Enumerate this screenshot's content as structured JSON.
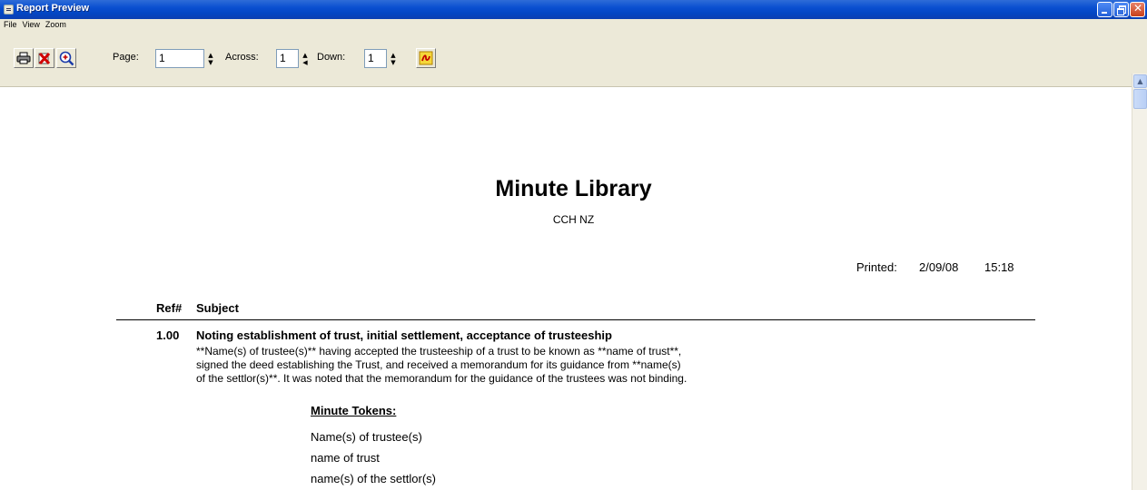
{
  "window": {
    "title": "Report Preview"
  },
  "menu": {
    "items": [
      "File",
      "View",
      "Zoom"
    ]
  },
  "toolbar": {
    "page_label": "Page:",
    "page_value": "1",
    "across_label": "Across:",
    "across_value": "1",
    "down_label": "Down:",
    "down_value": "1",
    "icons": [
      "printer-icon",
      "close-red-x-icon",
      "zoom-in-icon",
      "pdf-export-icon"
    ]
  },
  "report": {
    "title": "Minute Library",
    "subtitle": "CCH NZ",
    "printed_label": "Printed:",
    "printed_date": "2/09/08",
    "printed_time": "15:18",
    "col_ref": "Ref#",
    "col_subject": "Subject",
    "entries": [
      {
        "ref": "1.00",
        "subject": "Noting establishment of trust, initial settlement, acceptance of trusteeship",
        "body_lines": [
          "**Name(s) of trustee(s)** having accepted the trusteeship of a trust to be known as **name of trust**,",
          "signed the deed establishing the Trust, and received a memorandum for its guidance from **name(s)",
          "of the settlor(s)**. It was noted that the memorandum for the guidance of the trustees was not binding."
        ],
        "tokens_header": "Minute Tokens:",
        "tokens": [
          "Name(s) of trustee(s)",
          "name of trust",
          "name(s) of the settlor(s)"
        ]
      }
    ]
  }
}
